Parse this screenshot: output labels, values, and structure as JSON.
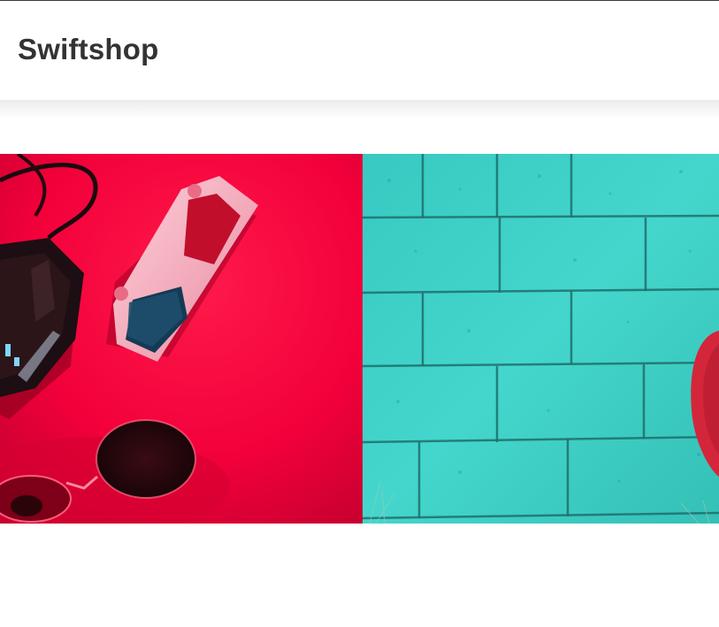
{
  "header": {
    "brand": "Swiftshop"
  },
  "hero": {
    "images": [
      {
        "name": "gaming-gear-on-red-photo",
        "background": "#f4003a"
      },
      {
        "name": "turquoise-brick-wall-photo",
        "background": "#3fd2c8"
      }
    ]
  },
  "colors": {
    "brand_text": "#333333",
    "red": "#f4003a",
    "turquoise": "#3fd2c8",
    "accent_red": "#d4263a"
  }
}
